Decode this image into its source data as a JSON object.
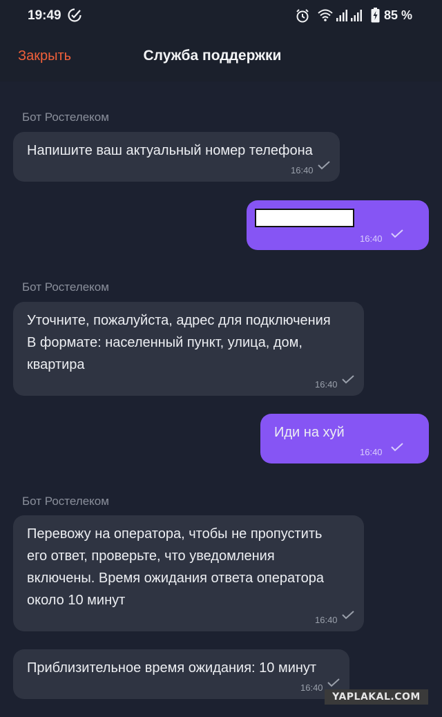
{
  "status_bar": {
    "time": "19:49",
    "battery": "85 %",
    "icons": [
      "check-circle-icon",
      "alarm-icon",
      "wifi-icon",
      "signal-icon",
      "signal-icon",
      "battery-charging-icon"
    ]
  },
  "header": {
    "close_label": "Закрыть",
    "title": "Служба поддержки"
  },
  "messages": [
    {
      "from": "bot",
      "sender": "Бот Ростелеком",
      "text": "Напишите ваш актуальный номер телефона",
      "time": "16:40"
    },
    {
      "from": "me",
      "text": "",
      "redacted": true,
      "time": "16:40"
    },
    {
      "from": "bot",
      "sender": "Бот Ростелеком",
      "text": "Уточните, пожалуйста, адрес для подключения\nВ формате: населенный пункт, улица, дом,\nквартира",
      "time": "16:40"
    },
    {
      "from": "me",
      "text": "Иди на хуй",
      "time": "16:40"
    },
    {
      "from": "bot",
      "sender": "Бот Ростелеком",
      "text": "Перевожу на оператора, чтобы не пропустить\nего ответ, проверьте, что уведомления\nвключены. Время ожидания ответа оператора\nоколо 10 минут",
      "time": "16:40"
    },
    {
      "from": "bot",
      "text": "Приблизительное время ожидания: 10 минут",
      "time": "16:40"
    }
  ],
  "watermark": "YAPLAKAL.COM",
  "colors": {
    "background": "#1c2130",
    "bot_bubble": "#2f3442",
    "user_bubble": "#8655f4",
    "accent": "#f0603a"
  }
}
